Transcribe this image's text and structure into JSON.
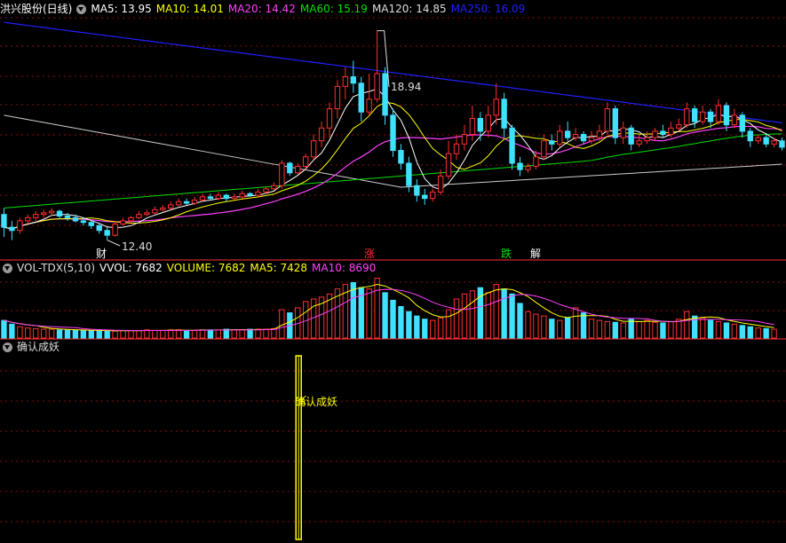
{
  "header": {
    "title": "洪兴股份(日线)",
    "ma": [
      {
        "label": "MA5: 13.95",
        "color": "#ffffff"
      },
      {
        "label": "MA10: 14.01",
        "color": "#ffff00"
      },
      {
        "label": "MA20: 14.42",
        "color": "#ff40ff"
      },
      {
        "label": "MA60: 15.19",
        "color": "#00e000"
      },
      {
        "label": "MA120: 14.85",
        "color": "#dddddd"
      },
      {
        "label": "MA250: 16.09",
        "color": "#2020ff"
      }
    ]
  },
  "vol_header": {
    "name": "VOL-TDX(5,10)",
    "items": [
      {
        "label": "VVOL: 7682",
        "color": "#ffffff"
      },
      {
        "label": "VOLUME: 7682",
        "color": "#ffff00"
      },
      {
        "label": "MA5: 7428",
        "color": "#ffff00"
      },
      {
        "label": "MA10: 8690",
        "color": "#ff40ff"
      }
    ]
  },
  "signal_header": {
    "name": "确认成妖"
  },
  "annotations": {
    "high": "18.94",
    "low": "12.40",
    "markers": [
      {
        "text": "财",
        "color": "#ffffff"
      },
      {
        "text": "涨",
        "color": "#ff3030"
      },
      {
        "text": "跌",
        "color": "#00e000"
      },
      {
        "text": "解",
        "color": "#ffffff"
      }
    ],
    "signal": "确认成妖"
  },
  "colors": {
    "up": "#ff3030",
    "down": "#40e0ff",
    "grid": "#8a1010",
    "signal": "#ffff00"
  },
  "chart_data": {
    "type": "candlestick",
    "yrange": [
      12.0,
      19.4
    ],
    "candles": [
      [
        13.2,
        12.8,
        13.4,
        12.5
      ],
      [
        12.8,
        12.7,
        13.0,
        12.4
      ],
      [
        12.7,
        13.0,
        13.1,
        12.6
      ],
      [
        13.0,
        13.1,
        13.2,
        12.9
      ],
      [
        13.1,
        13.2,
        13.3,
        13.0
      ],
      [
        13.2,
        13.25,
        13.35,
        13.1
      ],
      [
        13.25,
        13.3,
        13.4,
        13.15
      ],
      [
        13.3,
        13.15,
        13.35,
        13.05
      ],
      [
        13.15,
        13.1,
        13.25,
        13.0
      ],
      [
        13.1,
        13.0,
        13.2,
        12.95
      ],
      [
        13.0,
        12.95,
        13.1,
        12.85
      ],
      [
        12.95,
        12.85,
        13.0,
        12.75
      ],
      [
        12.85,
        12.7,
        12.95,
        12.6
      ],
      [
        12.7,
        12.55,
        12.8,
        12.4
      ],
      [
        12.55,
        12.9,
        13.0,
        12.5
      ],
      [
        12.9,
        13.0,
        13.1,
        12.85
      ],
      [
        13.0,
        13.1,
        13.15,
        12.95
      ],
      [
        13.1,
        13.2,
        13.3,
        13.05
      ],
      [
        13.2,
        13.25,
        13.35,
        13.15
      ],
      [
        13.25,
        13.35,
        13.45,
        13.2
      ],
      [
        13.35,
        13.4,
        13.5,
        13.3
      ],
      [
        13.4,
        13.5,
        13.6,
        13.35
      ],
      [
        13.5,
        13.6,
        13.7,
        13.45
      ],
      [
        13.6,
        13.55,
        13.7,
        13.5
      ],
      [
        13.55,
        13.65,
        13.75,
        13.5
      ],
      [
        13.65,
        13.75,
        13.85,
        13.6
      ],
      [
        13.75,
        13.7,
        13.85,
        13.65
      ],
      [
        13.7,
        13.8,
        13.9,
        13.65
      ],
      [
        13.8,
        13.7,
        13.85,
        13.6
      ],
      [
        13.7,
        13.75,
        13.85,
        13.65
      ],
      [
        13.75,
        13.85,
        13.95,
        13.7
      ],
      [
        13.85,
        13.8,
        13.9,
        13.75
      ],
      [
        13.8,
        13.9,
        14.0,
        13.75
      ],
      [
        13.9,
        14.0,
        14.05,
        13.85
      ],
      [
        14.0,
        14.1,
        14.2,
        13.95
      ],
      [
        14.1,
        14.8,
        14.9,
        14.0
      ],
      [
        14.8,
        14.5,
        14.85,
        14.4
      ],
      [
        14.5,
        14.7,
        14.8,
        14.45
      ],
      [
        14.7,
        15.0,
        15.1,
        14.6
      ],
      [
        15.0,
        15.5,
        15.7,
        14.9
      ],
      [
        15.5,
        15.9,
        16.1,
        15.3
      ],
      [
        15.9,
        16.5,
        16.7,
        15.6
      ],
      [
        16.5,
        17.2,
        17.4,
        16.2
      ],
      [
        17.2,
        17.5,
        17.8,
        16.8
      ],
      [
        17.5,
        17.3,
        18.0,
        17.0
      ],
      [
        17.3,
        16.4,
        17.5,
        16.1
      ],
      [
        16.4,
        16.8,
        17.6,
        16.3
      ],
      [
        16.8,
        17.6,
        18.94,
        16.7
      ],
      [
        17.6,
        16.3,
        17.8,
        16.0
      ],
      [
        16.3,
        15.2,
        16.5,
        15.0
      ],
      [
        15.2,
        14.8,
        15.4,
        14.6
      ],
      [
        14.8,
        14.1,
        15.0,
        13.9
      ],
      [
        14.1,
        13.8,
        14.3,
        13.6
      ],
      [
        13.8,
        13.7,
        14.0,
        13.5
      ],
      [
        13.7,
        13.9,
        14.0,
        13.6
      ],
      [
        13.9,
        14.4,
        14.6,
        13.8
      ],
      [
        14.4,
        15.1,
        15.5,
        14.3
      ],
      [
        15.1,
        15.4,
        15.7,
        14.9
      ],
      [
        15.4,
        15.7,
        16.0,
        15.2
      ],
      [
        15.7,
        16.2,
        16.6,
        15.5
      ],
      [
        16.2,
        15.8,
        16.4,
        15.5
      ],
      [
        15.8,
        16.3,
        16.6,
        15.6
      ],
      [
        16.3,
        16.8,
        17.3,
        16.0
      ],
      [
        16.8,
        15.9,
        17.0,
        15.6
      ],
      [
        15.9,
        14.8,
        16.0,
        14.6
      ],
      [
        14.8,
        14.6,
        15.0,
        14.4
      ],
      [
        14.6,
        14.7,
        14.8,
        14.5
      ],
      [
        14.7,
        15.0,
        15.2,
        14.6
      ],
      [
        15.0,
        15.5,
        15.7,
        14.9
      ],
      [
        15.5,
        15.4,
        15.7,
        15.2
      ],
      [
        15.4,
        15.8,
        16.0,
        15.3
      ],
      [
        15.8,
        15.6,
        16.1,
        15.5
      ],
      [
        15.6,
        15.7,
        15.9,
        15.5
      ],
      [
        15.7,
        15.5,
        15.8,
        15.4
      ],
      [
        15.5,
        15.6,
        15.8,
        15.4
      ],
      [
        15.6,
        15.8,
        16.0,
        15.5
      ],
      [
        15.8,
        16.5,
        16.7,
        15.7
      ],
      [
        16.5,
        15.6,
        16.6,
        15.4
      ],
      [
        15.6,
        15.9,
        16.1,
        15.4
      ],
      [
        15.9,
        15.4,
        16.0,
        15.2
      ],
      [
        15.4,
        15.5,
        15.7,
        15.3
      ],
      [
        15.5,
        15.6,
        15.8,
        15.4
      ],
      [
        15.6,
        15.8,
        15.9,
        15.5
      ],
      [
        15.8,
        15.7,
        16.0,
        15.6
      ],
      [
        15.7,
        15.9,
        16.1,
        15.6
      ],
      [
        15.9,
        16.0,
        16.2,
        15.8
      ],
      [
        16.0,
        16.5,
        16.7,
        15.9
      ],
      [
        16.5,
        16.1,
        16.6,
        15.9
      ],
      [
        16.1,
        16.4,
        16.6,
        16.0
      ],
      [
        16.4,
        16.1,
        16.5,
        15.9
      ],
      [
        16.1,
        16.6,
        16.8,
        16.0
      ],
      [
        16.6,
        16.0,
        16.7,
        15.8
      ],
      [
        16.0,
        16.3,
        16.5,
        15.9
      ],
      [
        16.3,
        15.8,
        16.4,
        15.6
      ],
      [
        15.8,
        15.5,
        15.9,
        15.3
      ],
      [
        15.5,
        15.6,
        15.7,
        15.4
      ],
      [
        15.6,
        15.4,
        15.7,
        15.3
      ],
      [
        15.4,
        15.5,
        15.6,
        15.3
      ],
      [
        15.5,
        15.3,
        15.6,
        15.2
      ]
    ],
    "volume": [
      28,
      22,
      18,
      16,
      15,
      14,
      14,
      13,
      13,
      12,
      12,
      12,
      12,
      11,
      11,
      12,
      12,
      12,
      13,
      12,
      12,
      13,
      13,
      12,
      12,
      13,
      13,
      13,
      14,
      13,
      13,
      14,
      14,
      14,
      15,
      45,
      40,
      48,
      58,
      62,
      65,
      70,
      78,
      85,
      88,
      80,
      78,
      95,
      72,
      60,
      50,
      42,
      35,
      30,
      28,
      32,
      45,
      62,
      70,
      75,
      80,
      72,
      85,
      78,
      70,
      55,
      42,
      38,
      35,
      30,
      28,
      32,
      48,
      40,
      30,
      28,
      26,
      25,
      24,
      30,
      26,
      28,
      25,
      24,
      26,
      30,
      42,
      35,
      32,
      28,
      26,
      24,
      22,
      20,
      18,
      16,
      15,
      14
    ],
    "signal_index": 37
  }
}
